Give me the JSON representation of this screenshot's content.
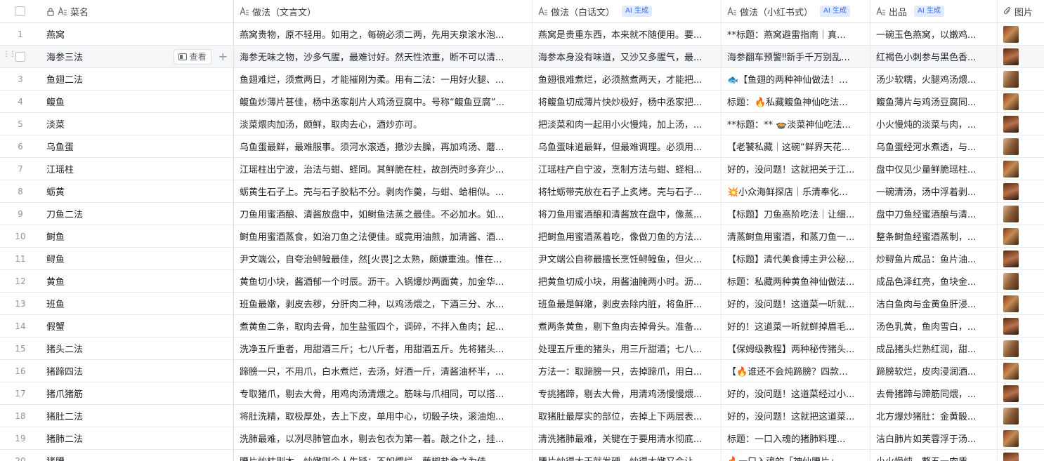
{
  "header": {
    "name": "菜名",
    "wyw": "做法（文言文）",
    "bhw": "做法（白话文）",
    "xhs": "做法（小红书式）",
    "out": "出品",
    "img": "图片",
    "ai_badge": "AI 生成"
  },
  "hover_row": {
    "view_label": "查看",
    "add_glyph": "+"
  },
  "rows": [
    {
      "num": "1",
      "name": "燕窝",
      "wyw": "燕窝贵物，原不轻用。如用之，每碗必须二两，先用天泉滚水泡...",
      "bhw": "燕窝是贵重东西，本来就不随便用。要...",
      "xhs": "**标题：燕窝避雷指南｜真…",
      "out": "一碗玉色燕窝，以嫩鸡..."
    },
    {
      "num": "",
      "name": "海参三法",
      "wyw": "海参无味之物，沙多气腥，最难讨好。然天性浓重，断不可以清...",
      "bhw": "海参本身没有味道，又沙又多腥气，最...",
      "xhs": "海参翻车预警‼新手千万别乱...",
      "out": "红褐色小刺参与黑色香..."
    },
    {
      "num": "3",
      "name": "鱼翅二法",
      "wyw": "鱼翅难烂，须煮两日，才能摧刚为柔。用有二法：一用好火腿、...",
      "bhw": "鱼翅很难煮烂，必须熬煮两天，才能把...",
      "xhs": "🐟【鱼翅的两种神仙做法！...",
      "out": "汤少软糯，火腿鸡汤煨..."
    },
    {
      "num": "4",
      "name": "鳆鱼",
      "wyw": "鳆鱼炒薄片甚佳，杨中丞家削片人鸡汤豆腐中。号称“鳆鱼豆腐”...",
      "bhw": "将鳆鱼切成薄片快炒极好，杨中丞家把...",
      "xhs": "标题：🔥私藏鳆鱼神仙吃法...",
      "out": "鳆鱼薄片与鸡汤豆腐同..."
    },
    {
      "num": "5",
      "name": "淡菜",
      "wyw": "淡菜煨肉加汤，颇鲜，取肉去心，酒炒亦可。",
      "bhw": "把淡菜和肉一起用小火慢炖，加上汤，...",
      "xhs": "**标题：** 🍲淡菜神仙吃法...",
      "out": "小火慢炖的淡菜与肉，..."
    },
    {
      "num": "6",
      "name": "乌鱼蛋",
      "wyw": "乌鱼蛋最鲜，最难服事。须河水滚透，撤沙去臊，再加鸡汤、蘑...",
      "bhw": "乌鱼蛋味道最鲜，但最难调理。必须用...",
      "xhs": "【老饕私藏｜这碗“鲜界天花...",
      "out": "乌鱼蛋经河水煮透，与..."
    },
    {
      "num": "7",
      "name": "江瑶柱",
      "wyw": "江瑶柱出宁波，治法与蚶、蛏同。其鲜脆在柱，故剖壳时多弃少...",
      "bhw": "江瑶柱产自宁波，烹制方法与蚶、蛏相...",
      "xhs": "好的，没问题！这就把关于江...",
      "out": "盘中仅见少量鲜脆瑶柱..."
    },
    {
      "num": "8",
      "name": "蛎黄",
      "wyw": "蛎黄生石子上。壳与石子胶粘不分。剥肉作羹，与蚶、蛤相似。...",
      "bhw": "将牡蛎带壳放在石子上炙烤。壳与石子...",
      "xhs": "💥小众海鲜探店｜乐清奉化...",
      "out": "一碗清汤，汤中浮着剥..."
    },
    {
      "num": "9",
      "name": "刀鱼二法",
      "wyw": "刀鱼用蜜酒酿、清酱放盘中，如鲥鱼法蒸之最佳。不必加水。如...",
      "bhw": "将刀鱼用蜜酒酿和清酱放在盘中，像蒸...",
      "xhs": "【标题】刀鱼高阶吃法｜让细...",
      "out": "盘中刀鱼经蜜酒酿与清..."
    },
    {
      "num": "10",
      "name": "鲥鱼",
      "wyw": "鲥鱼用蜜酒蒸食，如治刀鱼之法便佳。或竟用油煎，加清酱、酒...",
      "bhw": "把鲥鱼用蜜酒蒸着吃，像做刀鱼的方法...",
      "xhs": "清蒸鲥鱼用蜜酒，和蒸刀鱼一...",
      "out": "整条鲥鱼经蜜酒蒸制，..."
    },
    {
      "num": "11",
      "name": "鲟鱼",
      "wyw": "尹文端公，自夸治鲟鳇最佳，然[火畏]之太熟，颇嫌重浊。惟在...",
      "bhw": "尹文端公自称最擅长烹饪鲟鳇鱼，但火...",
      "xhs": "【标题】清代美食博主尹公秘...",
      "out": "炒鲟鱼片成品：鱼片油..."
    },
    {
      "num": "12",
      "name": "黄鱼",
      "wyw": "黄鱼切小块，酱酒郁一个时辰。沥干。入锅爆炒两面黄，加金华...",
      "bhw": "把黄鱼切成小块，用酱油腌两小时。沥...",
      "xhs": "标题：私藏两种黄鱼神仙做法...",
      "out": "成品色泽红亮，鱼块金..."
    },
    {
      "num": "13",
      "name": "班鱼",
      "wyw": "班鱼最嫩，剥皮去秽，分肝肉二种，以鸡汤煨之，下酒三分、水...",
      "bhw": "班鱼最是鲜嫩，剥皮去除内脏，将鱼肝...",
      "xhs": "好的，没问题！这道菜一听就...",
      "out": "洁白鱼肉与金黄鱼肝浸..."
    },
    {
      "num": "14",
      "name": "假蟹",
      "wyw": "煮黄鱼二条，取肉去骨，加生盐蛋四个，调碎，不拌入鱼肉；起...",
      "bhw": "煮两条黄鱼，剔下鱼肉去掉骨头。准备...",
      "xhs": "好的！这道菜一听就鲜掉眉毛...",
      "out": "汤色乳黄，鱼肉雪白，..."
    },
    {
      "num": "15",
      "name": "猪头二法",
      "wyw": "洗净五斤重者，用甜酒三斤；七八斤者，用甜酒五斤。先将猪头...",
      "bhw": "处理五斤重的猪头，用三斤甜酒；七八...",
      "xhs": "【保姆级教程】两种秘传猪头...",
      "out": "成品猪头烂熟红润，甜..."
    },
    {
      "num": "16",
      "name": "猪蹄四法",
      "wyw": "蹄膀一只，不用爪，白水煮烂，去汤，好酒一斤，清酱油杯半，...",
      "bhw": "方法一：取蹄膀一只，去掉蹄爪，用白...",
      "xhs": "【🔥谁还不会炖蹄膀？四款...",
      "out": "蹄膀软烂，皮肉浸润酒..."
    },
    {
      "num": "17",
      "name": "猪爪猪筋",
      "wyw": "专取猪爪，剔去大骨，用鸡肉汤清煨之。筋味与爪相同，可以搭...",
      "bhw": "专挑猪蹄，剔去大骨，用清鸡汤慢慢煨...",
      "xhs": "好的，没问题！这道菜经过小...",
      "out": "去骨猪蹄与蹄筋同煨，..."
    },
    {
      "num": "18",
      "name": "猪肚二法",
      "wyw": "将肚洗精，取极厚处，去上下皮，单用中心，切骰子块，滚油炮...",
      "bhw": "取猪肚最厚实的部位，去掉上下两层表...",
      "xhs": "好的，没问题！这就把这道菜...",
      "out": "北方爆炒猪肚：金黄骰..."
    },
    {
      "num": "19",
      "name": "猪肺二法",
      "wyw": "洗肺最难，以冽尽肺管血水，剔去包衣为第一着。敲之仆之，挂...",
      "bhw": "清洗猪肺最难，关键在于要用清水彻底...",
      "xhs": "标题：一口入魂的猪肺料理...",
      "out": "洁白肺片如芙蓉浮于汤..."
    },
    {
      "num": "20",
      "name": "猪腰",
      "wyw": "腰片炒枯则木，炒嫩则令人生疑；不如煨烂，蘸椒盐食之为佳。...",
      "bhw": "腰片炒得太干就发硬，炒得太嫩又会让...",
      "xhs": "🔥一口入魂的「神仙腰片」...",
      "out": "小火慢炖，整五一肉质..."
    }
  ],
  "icons": {
    "checkbox": "checkbox-icon",
    "lock": "lock-icon",
    "text_field": "text-field-icon",
    "attachment": "paperclip-icon",
    "drag": "drag-handle-icon",
    "view": "expand-view-icon",
    "add": "plus-icon"
  }
}
